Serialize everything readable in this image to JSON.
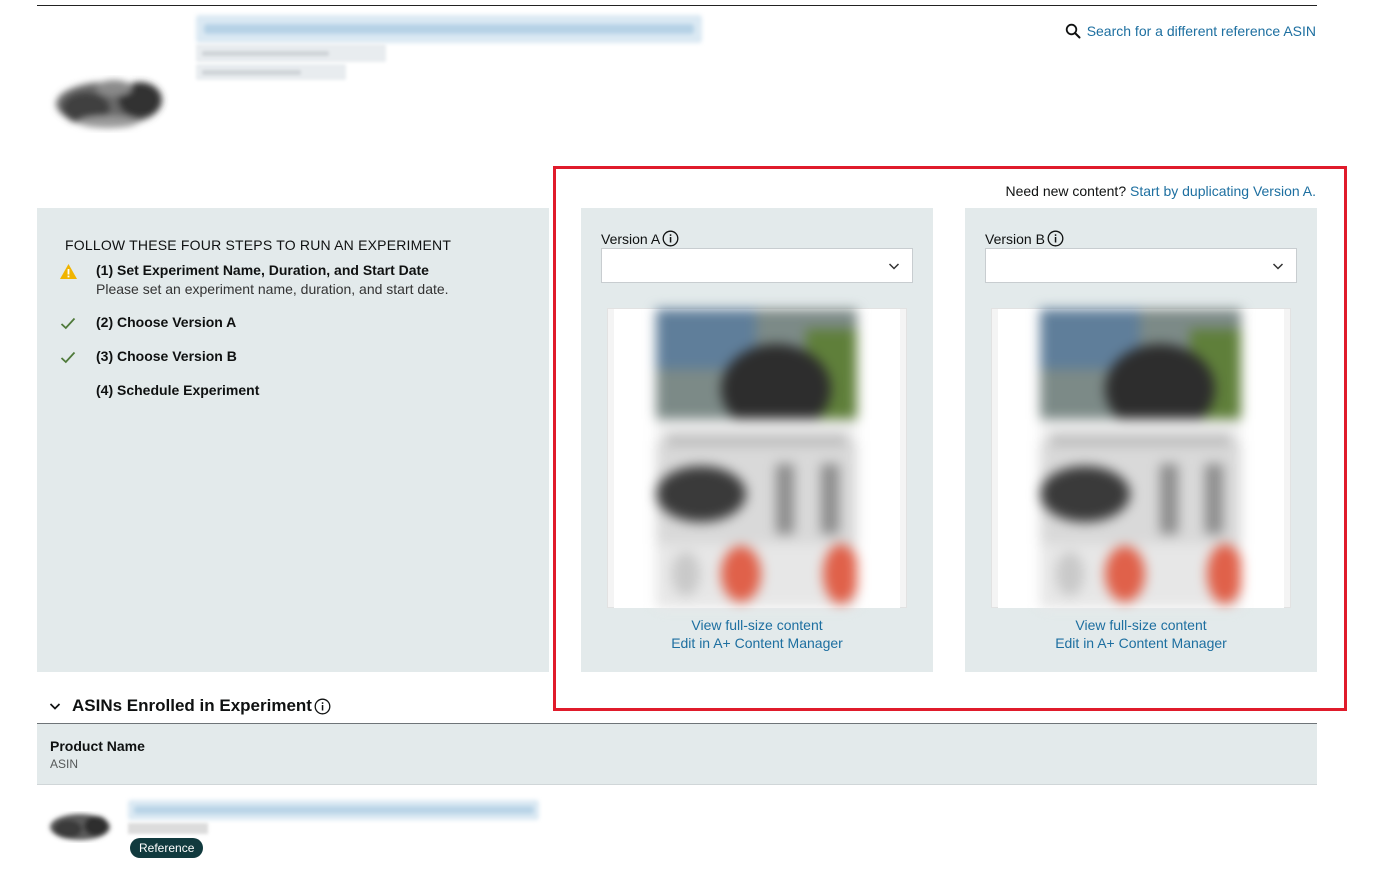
{
  "header": {
    "search_link": "Search for a different reference ASIN"
  },
  "steps": {
    "title": "FOLLOW THESE FOUR STEPS TO RUN AN EXPERIMENT",
    "items": [
      {
        "title": "(1) Set Experiment Name, Duration, and Start Date",
        "desc": "Please set an experiment name, duration, and start date.",
        "icon": "warning-icon"
      },
      {
        "title": "(2) Choose Version A",
        "icon": "check-icon"
      },
      {
        "title": "(3) Choose Version B",
        "icon": "check-icon"
      },
      {
        "title": "(4) Schedule Experiment",
        "icon": "none"
      }
    ]
  },
  "versions": {
    "need_text": "Need new content?",
    "need_link": "Start by duplicating Version A.",
    "a": {
      "label": "Version A",
      "selected": "",
      "view_link": "View full-size content",
      "edit_link": "Edit in A+ Content Manager"
    },
    "b": {
      "label": "Version B",
      "selected": "",
      "view_link": "View full-size content",
      "edit_link": "Edit in A+ Content Manager"
    }
  },
  "enrolled": {
    "title": "ASINs Enrolled in Experiment",
    "col_name": "Product Name",
    "col_asin": "ASIN",
    "rows": [
      {
        "badge": "Reference"
      }
    ]
  },
  "colors": {
    "link": "#1d6fa0",
    "panel": "#e3eaeb",
    "highlight": "#e01b2b",
    "warning": "#f0b400",
    "check": "#4f7a3a",
    "badge": "#113a3e"
  }
}
